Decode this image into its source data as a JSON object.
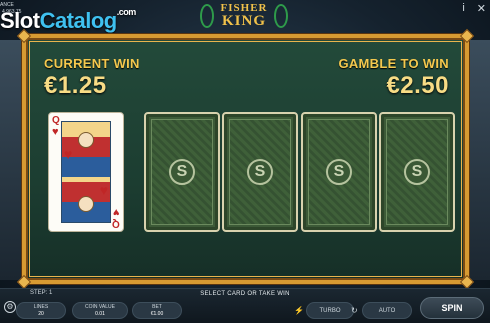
{
  "watermark": {
    "slot": "Slot",
    "catalog": "Catalog",
    "dotcom": ".com"
  },
  "header_info": {
    "line1": "ANCE",
    "line2": "4,963.75"
  },
  "logo": {
    "line1": "FISHER",
    "line2": "KING"
  },
  "top_icons": {
    "info": "i",
    "close": "✕"
  },
  "current_win": {
    "label": "CURRENT WIN",
    "value": "€1.25"
  },
  "gamble_to_win": {
    "label": "GAMBLE TO WIN",
    "value": "€2.50"
  },
  "revealed_card": {
    "rank": "Q",
    "suit": "♥"
  },
  "card_backs": [
    {
      "emblem": "S"
    },
    {
      "emblem": "S"
    },
    {
      "emblem": "S"
    },
    {
      "emblem": "S"
    }
  ],
  "bottom": {
    "step": "STEP: 1",
    "message": "SELECT CARD OR TAKE WIN",
    "lines": {
      "label": "LINES",
      "value": "20"
    },
    "coin_value": {
      "label": "COIN VALUE",
      "value": "0.01"
    },
    "bet": {
      "label": "BET",
      "value": "€1.00"
    },
    "turbo": "TURBO",
    "auto": "AUTO",
    "spin": "SPIN"
  },
  "colors": {
    "frame": "#d79a32",
    "win_text": "#f4c84e",
    "felt": "#234a3a"
  }
}
